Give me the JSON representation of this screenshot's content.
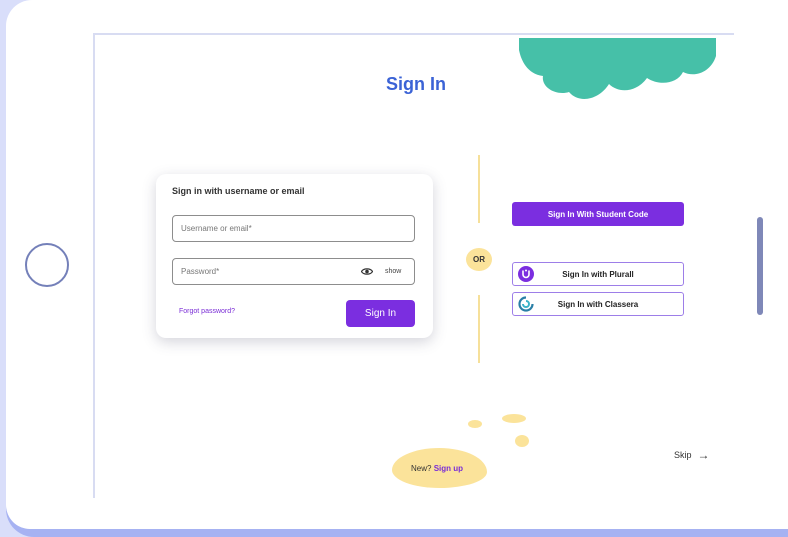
{
  "page": {
    "title": "Sign In"
  },
  "login_card": {
    "heading": "Sign in with username or email",
    "username_placeholder": "Username or email*",
    "password_placeholder": "Password*",
    "show_label": "show",
    "forgot_label": "Forgot password?",
    "signin_label": "Sign In"
  },
  "divider": {
    "or_label": "OR"
  },
  "alt_signin": {
    "student_code_label": "Sign In With Student Code",
    "plurall_label": "Sign In with Plurall",
    "plurall_icon": "plurall-logo-icon",
    "classera_label": "Sign In with Classera",
    "classera_icon": "classera-logo-icon"
  },
  "footer": {
    "new_prefix": "New?",
    "signup_label": "Sign up",
    "skip_label": "Skip",
    "skip_icon": "arrow-right-icon"
  },
  "colors": {
    "accent": "#7b2ee0",
    "title": "#3b63d6",
    "decor_green": "#46c0a8",
    "decor_yellow": "#fbe39a"
  }
}
